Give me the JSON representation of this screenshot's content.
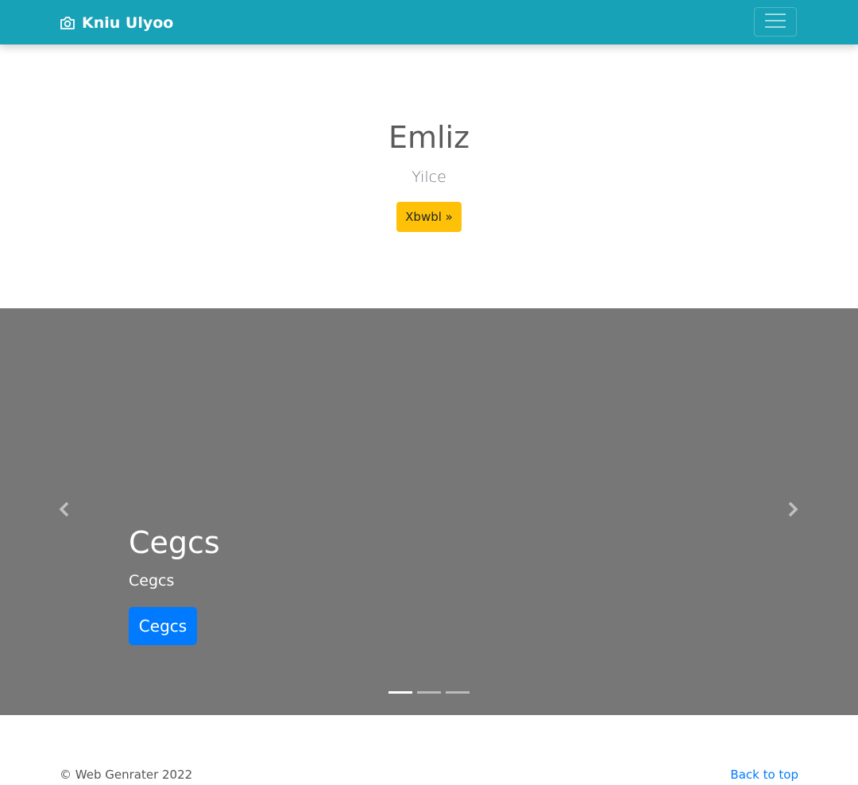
{
  "navbar": {
    "brand_text": "Kniu Ulyoo",
    "brand_icon": "camera-icon",
    "toggler_icon": "hamburger-menu-icon",
    "background_color": "#17a2b8"
  },
  "hero": {
    "title": "Emliz",
    "subtitle": "Yilce",
    "button_label": "Xbwbl »",
    "button_color": "#ffc107"
  },
  "carousel": {
    "background_color": "#777777",
    "prev_icon": "chevron-left-icon",
    "next_icon": "chevron-right-icon",
    "slide": {
      "title": "Cegcs",
      "text": "Cegcs",
      "button_label": "Cegcs",
      "button_color": "#007bff"
    },
    "indicator_count": 3,
    "active_indicator": 1
  },
  "footer": {
    "copyright": "© Web Genrater 2022",
    "back_to_top": "Back to top"
  }
}
